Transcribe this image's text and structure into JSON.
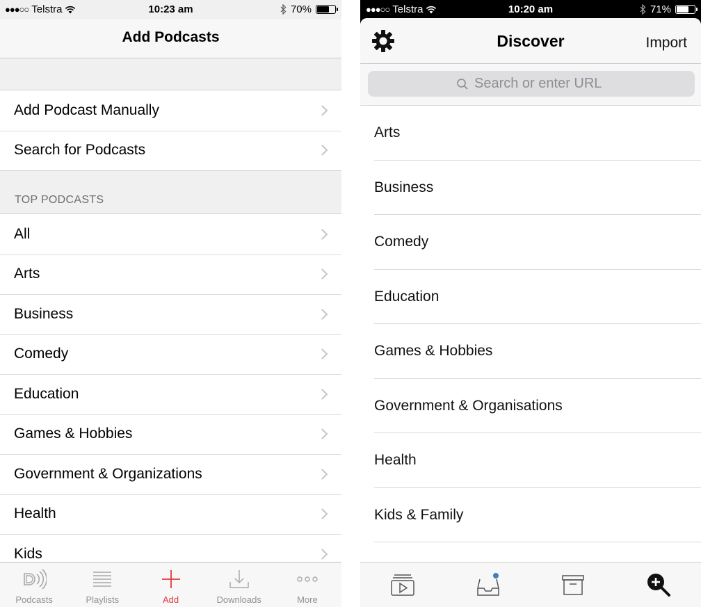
{
  "left": {
    "status": {
      "carrier": "Telstra",
      "time": "10:23 am",
      "battery": "70%",
      "battery_level": 0.7
    },
    "nav_title": "Add Podcasts",
    "actions": [
      {
        "label": "Add Podcast Manually"
      },
      {
        "label": "Search for Podcasts"
      }
    ],
    "section_header": "TOP PODCASTS",
    "categories": [
      {
        "label": "All"
      },
      {
        "label": "Arts"
      },
      {
        "label": "Business"
      },
      {
        "label": "Comedy"
      },
      {
        "label": "Education"
      },
      {
        "label": "Games & Hobbies"
      },
      {
        "label": "Government & Organizations"
      },
      {
        "label": "Health"
      },
      {
        "label": "Kids"
      }
    ],
    "tabs": [
      {
        "label": "Podcasts",
        "icon": "podcasts-icon"
      },
      {
        "label": "Playlists",
        "icon": "playlists-icon"
      },
      {
        "label": "Add",
        "icon": "plus-icon"
      },
      {
        "label": "Downloads",
        "icon": "downloads-icon"
      },
      {
        "label": "More",
        "icon": "more-icon"
      }
    ],
    "active_tab": "Add",
    "accent_color": "#e0393e"
  },
  "right": {
    "status": {
      "carrier": "Telstra",
      "time": "10:20 am",
      "battery": "71%",
      "battery_level": 0.71
    },
    "nav_title": "Discover",
    "import_label": "Import",
    "search_placeholder": "Search or enter URL",
    "categories": [
      {
        "label": "Arts"
      },
      {
        "label": "Business"
      },
      {
        "label": "Comedy"
      },
      {
        "label": "Education"
      },
      {
        "label": "Games & Hobbies"
      },
      {
        "label": "Government & Organisations"
      },
      {
        "label": "Health"
      },
      {
        "label": "Kids & Family"
      }
    ],
    "toolbar_icons": [
      "now-playing-icon",
      "inbox-icon",
      "archive-icon",
      "discover-zoom-icon"
    ],
    "badge_color": "#3b7fc4"
  }
}
